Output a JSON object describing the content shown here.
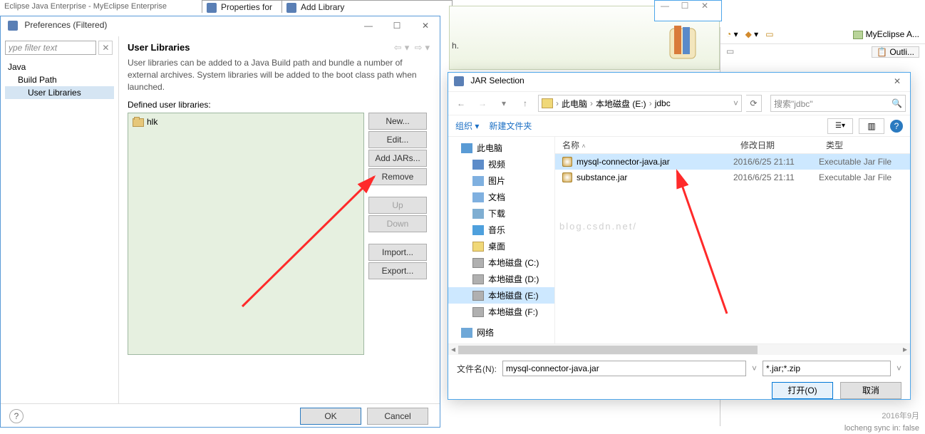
{
  "bg": {
    "eclipse_perspective": "Eclipse Java Enterprise - MyEclipse Enterprise",
    "properties_title": "Properties for",
    "addlib_title": "Add Library",
    "search_hint_h": "h.",
    "myeclipse_tab": "MyEclipse A...",
    "outline_tab": "Outli...",
    "status_date": "2016年9月",
    "status_sync": "locheng sync in: false"
  },
  "pref": {
    "title": "Preferences (Filtered)",
    "filter_placeholder": "ype filter text",
    "tree": {
      "java": "Java",
      "build_path": "Build Path",
      "user_libs": "User Libraries"
    },
    "heading": "User Libraries",
    "desc": "User libraries can be added to a Java Build path and bundle a number of external archives. System libraries will be added to the boot class path when launched.",
    "defined_label": "Defined user libraries:",
    "library_name": "hlk",
    "buttons": {
      "new": "New...",
      "edit": "Edit...",
      "add_jars": "Add JARs...",
      "remove": "Remove",
      "up": "Up",
      "down": "Down",
      "import": "Import...",
      "export": "Export..."
    },
    "footer": {
      "ok": "OK",
      "cancel": "Cancel",
      "help": "?"
    }
  },
  "jar": {
    "title": "JAR Selection",
    "breadcrumb": {
      "pc": "此电脑",
      "drive": "本地磁盘 (E:)",
      "folder": "jdbc"
    },
    "search_placeholder": "搜索\"jdbc\"",
    "toolbar": {
      "organize": "组织",
      "new_folder": "新建文件夹"
    },
    "columns": {
      "name": "名称",
      "date": "修改日期",
      "type": "类型"
    },
    "tree": {
      "pc": "此电脑",
      "video": "视频",
      "pictures": "图片",
      "docs": "文档",
      "downloads": "下载",
      "music": "音乐",
      "desktop": "桌面",
      "drive_c": "本地磁盘 (C:)",
      "drive_d": "本地磁盘 (D:)",
      "drive_e": "本地磁盘 (E:)",
      "drive_f": "本地磁盘 (F:)",
      "network": "网络"
    },
    "files": [
      {
        "name": "mysql-connector-java.jar",
        "date": "2016/6/25 21:11",
        "type": "Executable Jar File",
        "selected": true
      },
      {
        "name": "substance.jar",
        "date": "2016/6/25 21:11",
        "type": "Executable Jar File",
        "selected": false
      }
    ],
    "watermark": "blog.csdn.net/",
    "filename_label": "文件名(N):",
    "filename_value": "mysql-connector-java.jar",
    "filter_value": "*.jar;*.zip",
    "open": "打开(O)",
    "cancel": "取消"
  }
}
